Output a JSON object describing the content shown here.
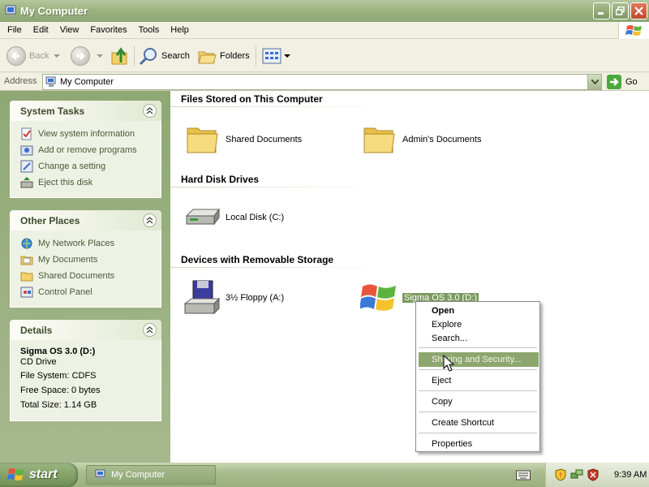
{
  "window": {
    "title": "My Computer"
  },
  "menu": [
    "File",
    "Edit",
    "View",
    "Favorites",
    "Tools",
    "Help"
  ],
  "toolbar": {
    "back": "Back",
    "search": "Search",
    "folders": "Folders"
  },
  "address": {
    "label": "Address",
    "value": "My Computer",
    "go": "Go"
  },
  "system_tasks": {
    "title": "System Tasks",
    "items": [
      "View system information",
      "Add or remove programs",
      "Change a setting",
      "Eject this disk"
    ]
  },
  "other_places": {
    "title": "Other Places",
    "items": [
      "My Network Places",
      "My Documents",
      "Shared Documents",
      "Control Panel"
    ]
  },
  "details": {
    "title": "Details",
    "name": "Sigma OS 3.0 (D:)",
    "type": "CD Drive",
    "file_system": "File System: CDFS",
    "free_space": "Free Space: 0 bytes",
    "total_size": "Total Size: 1.14 GB"
  },
  "groups": {
    "files": {
      "title": "Files Stored on This Computer",
      "items": [
        "Shared Documents",
        "Admin's Documents"
      ]
    },
    "hdd": {
      "title": "Hard Disk Drives",
      "items": [
        "Local Disk (C:)"
      ]
    },
    "removable": {
      "title": "Devices with Removable Storage",
      "items": [
        "3½ Floppy (A:)",
        "Sigma OS 3.0 (D:)"
      ]
    }
  },
  "context_menu": {
    "items": [
      "Open",
      "Explore",
      "Search...",
      "Sharing and Security...",
      "Eject",
      "Copy",
      "Create Shortcut",
      "Properties"
    ],
    "highlighted": "Sharing and Security..."
  },
  "taskbar": {
    "start": "start",
    "window": "My Computer",
    "clock": "9:39 AM"
  },
  "colors": {
    "accent": "#8da66f",
    "title_bar": "#9cb37f",
    "left_pane": "#a6b98e"
  }
}
